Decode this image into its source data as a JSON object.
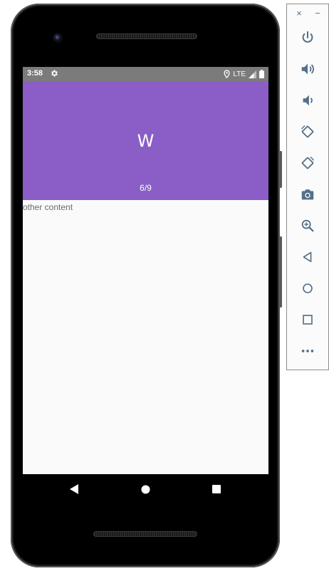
{
  "status_bar": {
    "time": "3:58",
    "network": "LTE"
  },
  "icons": {
    "status": [
      "gear-icon",
      "location-icon",
      "signal-icon",
      "battery-icon"
    ],
    "nav": [
      "back-icon",
      "home-icon",
      "recents-icon"
    ],
    "toolbar": [
      "close-icon",
      "minimize-icon",
      "power-icon",
      "volume-up-icon",
      "volume-down-icon",
      "rotate-left-icon",
      "rotate-right-icon",
      "camera-icon",
      "zoom-icon",
      "back-icon",
      "home-icon",
      "overview-icon",
      "more-icon"
    ]
  },
  "banner": {
    "title": "W",
    "counter": "6/9",
    "color": "#8a5ec6"
  },
  "content": {
    "other_text": "other content"
  },
  "toolbar": {
    "close_glyph": "×",
    "minimize_glyph": "−",
    "icon_color": "#557088"
  }
}
